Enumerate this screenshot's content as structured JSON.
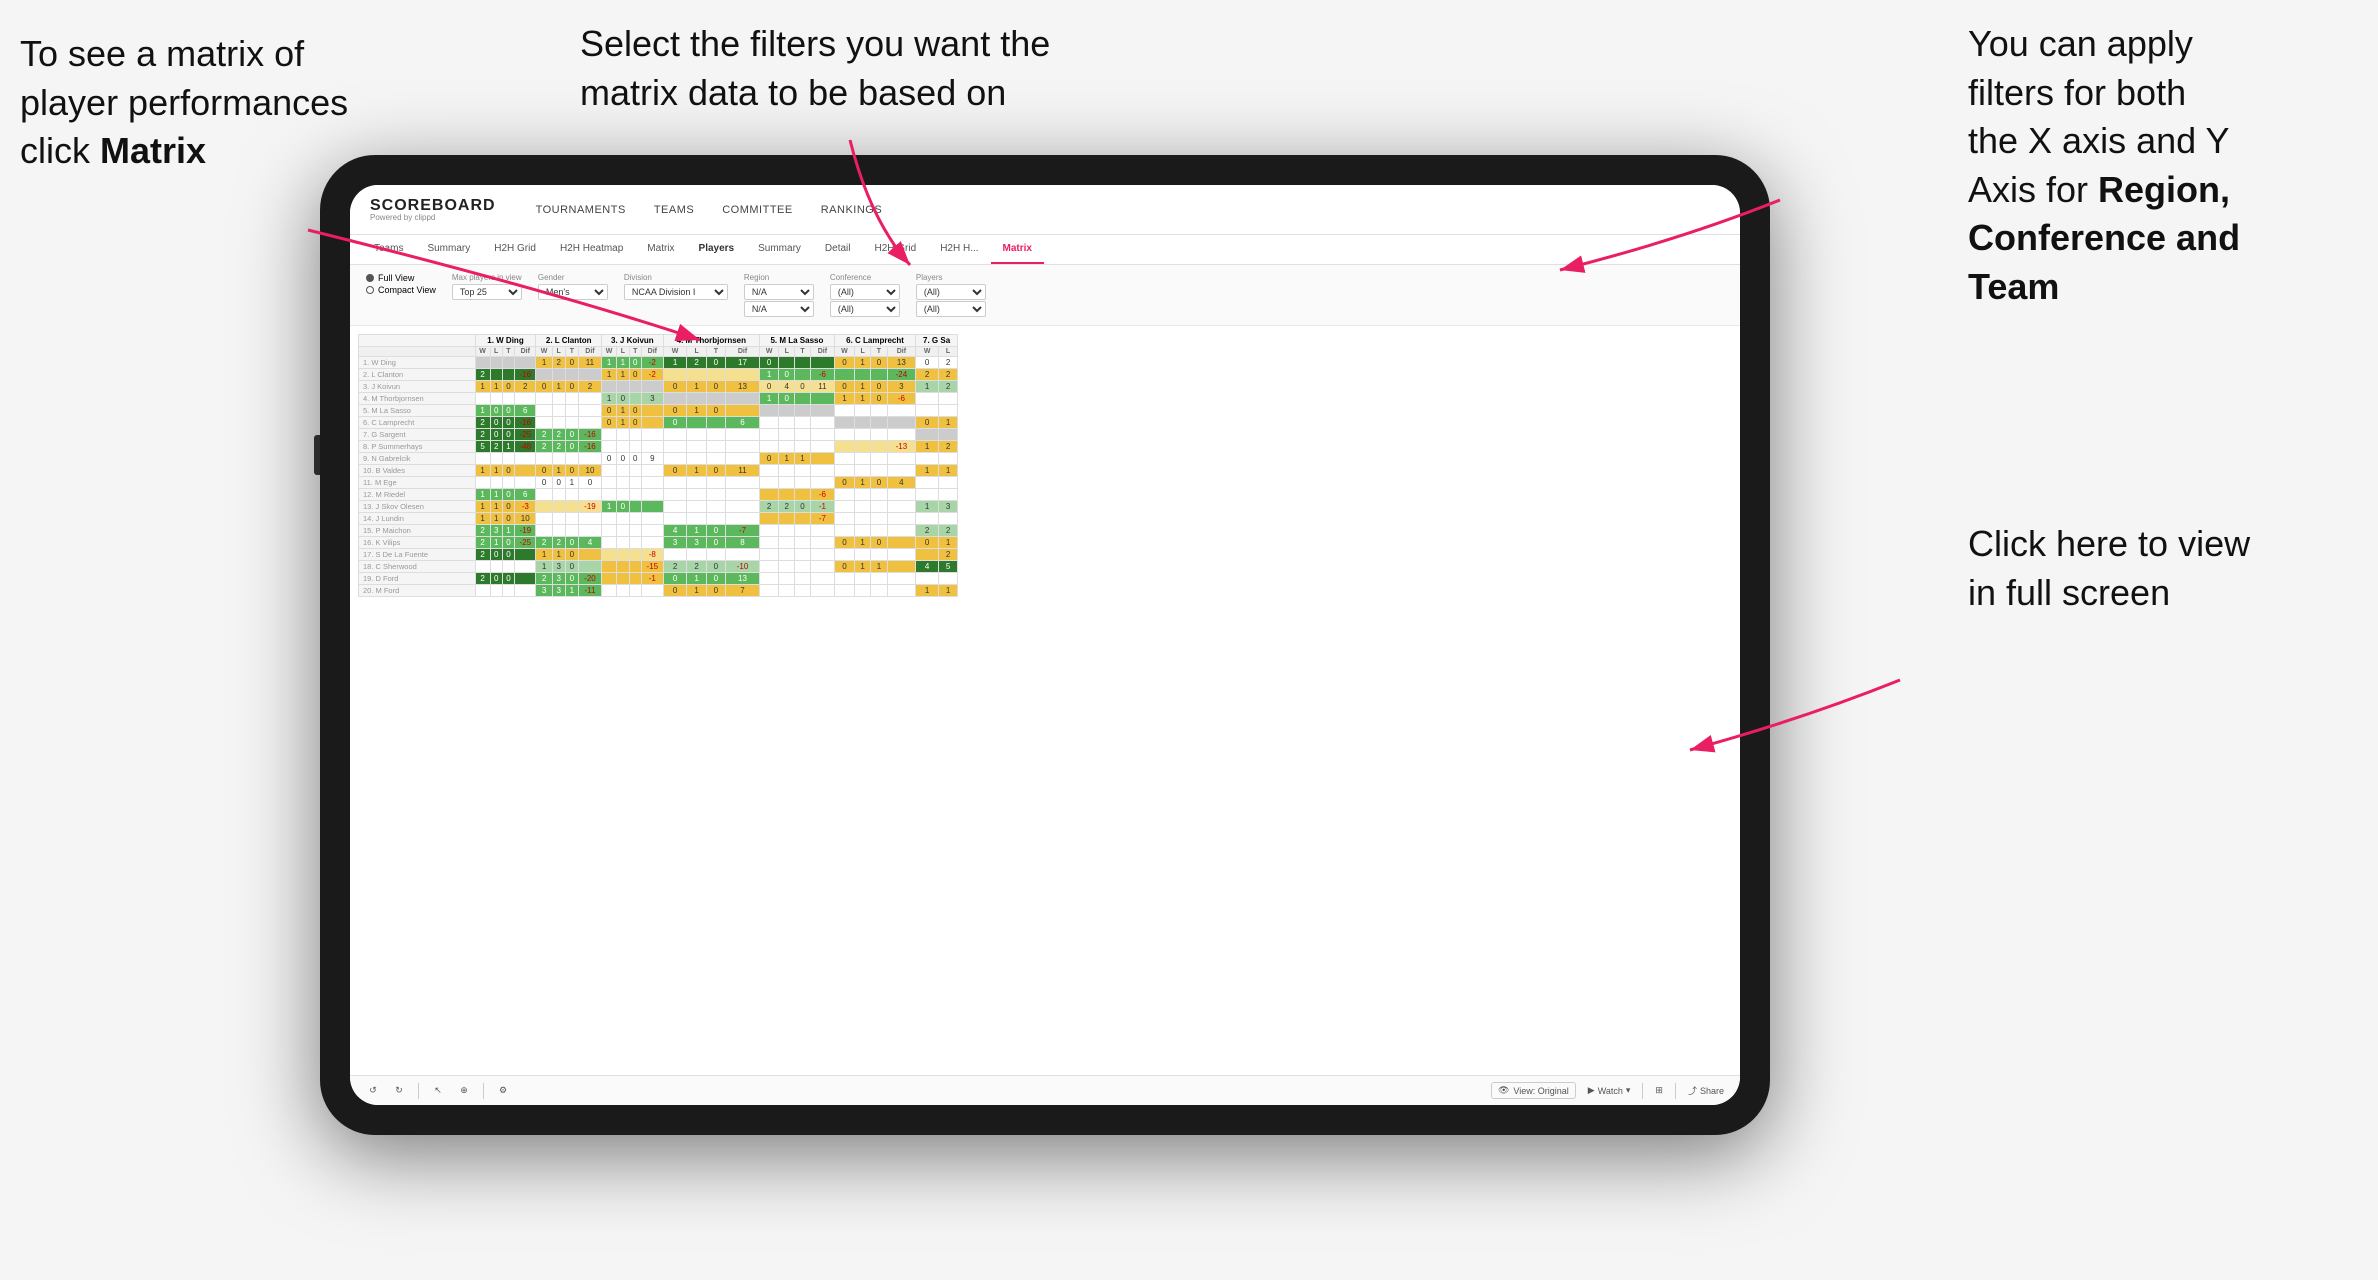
{
  "annotations": {
    "top_left": {
      "line1": "To see a matrix of",
      "line2": "player performances",
      "line3_prefix": "click ",
      "line3_bold": "Matrix"
    },
    "top_center": {
      "text": "Select the filters you want the matrix data to be based on"
    },
    "top_right": {
      "line1": "You  can apply",
      "line2": "filters for both",
      "line3": "the X axis and Y",
      "line4_prefix": "Axis for ",
      "line4_bold": "Region,",
      "line5_bold": "Conference and",
      "line6_bold": "Team"
    },
    "bottom_right": {
      "line1": "Click here to view",
      "line2": "in full screen"
    }
  },
  "nav": {
    "logo": "SCOREBOARD",
    "logo_sub": "Powered by clippd",
    "items": [
      "TOURNAMENTS",
      "TEAMS",
      "COMMITTEE",
      "RANKINGS"
    ]
  },
  "sub_nav": {
    "items": [
      "Teams",
      "Summary",
      "H2H Grid",
      "H2H Heatmap",
      "Matrix",
      "Players",
      "Summary",
      "Detail",
      "H2H Grid",
      "H2H H...",
      "Matrix"
    ],
    "active_index": 10
  },
  "filters": {
    "view_options": [
      "Full View",
      "Compact View"
    ],
    "selected_view": "Full View",
    "max_players_label": "Max players in view",
    "max_players_value": "Top 25",
    "gender_label": "Gender",
    "gender_value": "Men's",
    "division_label": "Division",
    "division_value": "NCAA Division I",
    "region_label": "Region",
    "region_values": [
      "N/A",
      "N/A"
    ],
    "conference_label": "Conference",
    "conference_values": [
      "(All)",
      "(All)"
    ],
    "players_label": "Players",
    "players_values": [
      "(All)",
      "(All)"
    ]
  },
  "matrix": {
    "col_headers": [
      "1. W Ding",
      "2. L Clanton",
      "3. J Koivun",
      "4. M Thorbjornsen",
      "5. M La Sasso",
      "6. C Lamprecht",
      "7. G Sa"
    ],
    "sub_cols": [
      "W",
      "L",
      "T",
      "Dif"
    ],
    "rows": [
      {
        "name": "1. W Ding",
        "cells": [
          [
            null,
            null,
            null,
            null
          ],
          [
            1,
            2,
            0,
            11
          ],
          [
            1,
            1,
            0,
            -2
          ],
          [
            1,
            2,
            0,
            17
          ],
          [
            0,
            null,
            null,
            null
          ],
          [
            0,
            1,
            0,
            13
          ],
          [
            0,
            2
          ]
        ]
      },
      {
        "name": "2. L Clanton",
        "cells": [
          [
            2,
            null,
            null,
            -16
          ],
          [
            null,
            null,
            null,
            null
          ],
          [
            1,
            1,
            0,
            -2
          ],
          [
            null,
            null,
            null,
            null
          ],
          [
            1,
            0,
            null,
            -6
          ],
          [
            null,
            null,
            null,
            -24
          ],
          [
            2,
            2
          ]
        ]
      },
      {
        "name": "3. J Koivun",
        "cells": [
          [
            1,
            1,
            0,
            2
          ],
          [
            0,
            1,
            0,
            2
          ],
          [
            null,
            null,
            null,
            null
          ],
          [
            0,
            1,
            0,
            13
          ],
          [
            0,
            4,
            0,
            11
          ],
          [
            0,
            1,
            0,
            3
          ],
          [
            1,
            2
          ]
        ]
      },
      {
        "name": "4. M Thorbjornsen",
        "cells": [
          [
            null,
            null,
            null,
            null
          ],
          [
            null,
            null,
            null,
            null
          ],
          [
            1,
            0,
            null,
            3
          ],
          [
            null,
            null,
            null,
            null
          ],
          [
            1,
            0,
            null,
            null
          ],
          [
            1,
            1,
            0,
            -6
          ],
          [
            null,
            null
          ]
        ]
      },
      {
        "name": "5. M La Sasso",
        "cells": [
          [
            1,
            0,
            0,
            6
          ],
          [
            null,
            null,
            null,
            null
          ],
          [
            0,
            1,
            0,
            null
          ],
          [
            0,
            1,
            0,
            null
          ],
          [
            null,
            null,
            null,
            null
          ],
          [
            null,
            null,
            null,
            null
          ],
          [
            null,
            null
          ]
        ]
      },
      {
        "name": "6. C Lamprecht",
        "cells": [
          [
            2,
            0,
            0,
            -16
          ],
          [
            null,
            null,
            null,
            null
          ],
          [
            0,
            1,
            0,
            null
          ],
          [
            0,
            null,
            null,
            6
          ],
          [
            null,
            null,
            null,
            null
          ],
          [
            null,
            null,
            null,
            null
          ],
          [
            0,
            1
          ]
        ]
      },
      {
        "name": "7. G Sargent",
        "cells": [
          [
            2,
            0,
            0,
            -25
          ],
          [
            2,
            2,
            0,
            -16
          ],
          [
            null,
            null,
            null,
            null
          ],
          [
            null,
            null,
            null,
            null
          ],
          [
            null,
            null,
            null,
            null
          ],
          [
            null,
            null,
            null,
            null
          ],
          [
            null,
            null
          ]
        ]
      },
      {
        "name": "8. P Summerhays",
        "cells": [
          [
            5,
            2,
            1,
            -48
          ],
          [
            2,
            2,
            0,
            -16
          ],
          [
            null,
            null,
            null,
            null
          ],
          [
            null,
            null,
            null,
            null
          ],
          [
            null,
            null,
            null,
            null
          ],
          [
            null,
            null,
            null,
            -13
          ],
          [
            1,
            2
          ]
        ]
      },
      {
        "name": "9. N Gabrelcik",
        "cells": [
          [
            null,
            null,
            null,
            null
          ],
          [
            null,
            null,
            null,
            null
          ],
          [
            0,
            0,
            0,
            9
          ],
          [
            null,
            null,
            null,
            null
          ],
          [
            0,
            1,
            1,
            null
          ],
          [
            null,
            null,
            null,
            null
          ],
          [
            null,
            null
          ]
        ]
      },
      {
        "name": "10. B Valdes",
        "cells": [
          [
            1,
            1,
            0,
            null
          ],
          [
            0,
            1,
            0,
            10
          ],
          [
            null,
            null,
            null,
            null
          ],
          [
            0,
            1,
            0,
            11
          ],
          [
            null,
            null,
            null,
            null
          ],
          [
            null,
            null,
            null,
            null
          ],
          [
            1,
            1
          ]
        ]
      },
      {
        "name": "11. M Ege",
        "cells": [
          [
            null,
            null,
            null,
            null
          ],
          [
            0,
            0,
            1,
            0
          ],
          [
            null,
            null,
            null,
            null
          ],
          [
            null,
            null,
            null,
            null
          ],
          [
            null,
            null,
            null,
            null
          ],
          [
            0,
            1,
            0,
            4
          ],
          [
            null,
            null
          ]
        ]
      },
      {
        "name": "12. M Riedel",
        "cells": [
          [
            1,
            1,
            0,
            6
          ],
          [
            null,
            null,
            null,
            null
          ],
          [
            null,
            null,
            null,
            null
          ],
          [
            null,
            null,
            null,
            null
          ],
          [
            null,
            null,
            null,
            -6
          ],
          [
            null,
            null,
            null,
            null
          ],
          [
            null,
            null
          ]
        ]
      },
      {
        "name": "13. J Skov Olesen",
        "cells": [
          [
            1,
            1,
            0,
            -3
          ],
          [
            null,
            null,
            null,
            -19
          ],
          [
            1,
            0,
            null,
            null
          ],
          [
            null,
            null,
            null,
            null
          ],
          [
            2,
            2,
            0,
            -1
          ],
          [
            null,
            null,
            null,
            null
          ],
          [
            1,
            3
          ]
        ]
      },
      {
        "name": "14. J Lundin",
        "cells": [
          [
            1,
            1,
            0,
            10
          ],
          [
            null,
            null,
            null,
            null
          ],
          [
            null,
            null,
            null,
            null
          ],
          [
            null,
            null,
            null,
            null
          ],
          [
            null,
            null,
            null,
            -7
          ],
          [
            null,
            null,
            null,
            null
          ],
          [
            null,
            null
          ]
        ]
      },
      {
        "name": "15. P Maichon",
        "cells": [
          [
            2,
            3,
            1,
            -19
          ],
          [
            null,
            null,
            null,
            null
          ],
          [
            null,
            null,
            null,
            null
          ],
          [
            4,
            1,
            0,
            -7
          ],
          [
            null,
            null,
            null,
            null
          ],
          [
            null,
            null,
            null,
            null
          ],
          [
            2,
            2
          ]
        ]
      },
      {
        "name": "16. K Vilips",
        "cells": [
          [
            2,
            1,
            0,
            -25
          ],
          [
            2,
            2,
            0,
            4
          ],
          [
            null,
            null,
            null,
            null
          ],
          [
            3,
            3,
            0,
            8
          ],
          [
            null,
            null,
            null,
            null
          ],
          [
            0,
            1,
            0,
            null
          ],
          [
            0,
            1
          ]
        ]
      },
      {
        "name": "17. S De La Fuente",
        "cells": [
          [
            2,
            0,
            0,
            null
          ],
          [
            1,
            1,
            0,
            null
          ],
          [
            null,
            null,
            null,
            -8
          ],
          [
            null,
            null,
            null,
            null
          ],
          [
            null,
            null,
            null,
            null
          ],
          [
            null,
            null,
            null,
            null
          ],
          [
            null,
            2
          ]
        ]
      },
      {
        "name": "18. C Sherwood",
        "cells": [
          [
            null,
            null,
            null,
            null
          ],
          [
            1,
            3,
            0,
            null
          ],
          [
            null,
            null,
            null,
            -15
          ],
          [
            2,
            2,
            0,
            -10
          ],
          [
            null,
            null,
            null,
            null
          ],
          [
            0,
            1,
            1,
            null
          ],
          [
            4,
            5
          ]
        ]
      },
      {
        "name": "19. D Ford",
        "cells": [
          [
            2,
            0,
            0,
            null
          ],
          [
            2,
            3,
            0,
            -20
          ],
          [
            null,
            null,
            null,
            -1
          ],
          [
            0,
            1,
            0,
            13
          ],
          [
            null,
            null,
            null,
            null
          ],
          [
            null,
            null,
            null,
            null
          ],
          [
            null,
            null
          ]
        ]
      },
      {
        "name": "20. M Ford",
        "cells": [
          [
            null,
            null,
            null,
            null
          ],
          [
            3,
            3,
            1,
            -11
          ],
          [
            null,
            null,
            null,
            null
          ],
          [
            0,
            1,
            0,
            7
          ],
          [
            null,
            null,
            null,
            null
          ],
          [
            null,
            null,
            null,
            null
          ],
          [
            1,
            1
          ]
        ]
      }
    ]
  },
  "toolbar": {
    "view_label": "View: Original",
    "watch_label": "Watch",
    "share_label": "Share"
  }
}
